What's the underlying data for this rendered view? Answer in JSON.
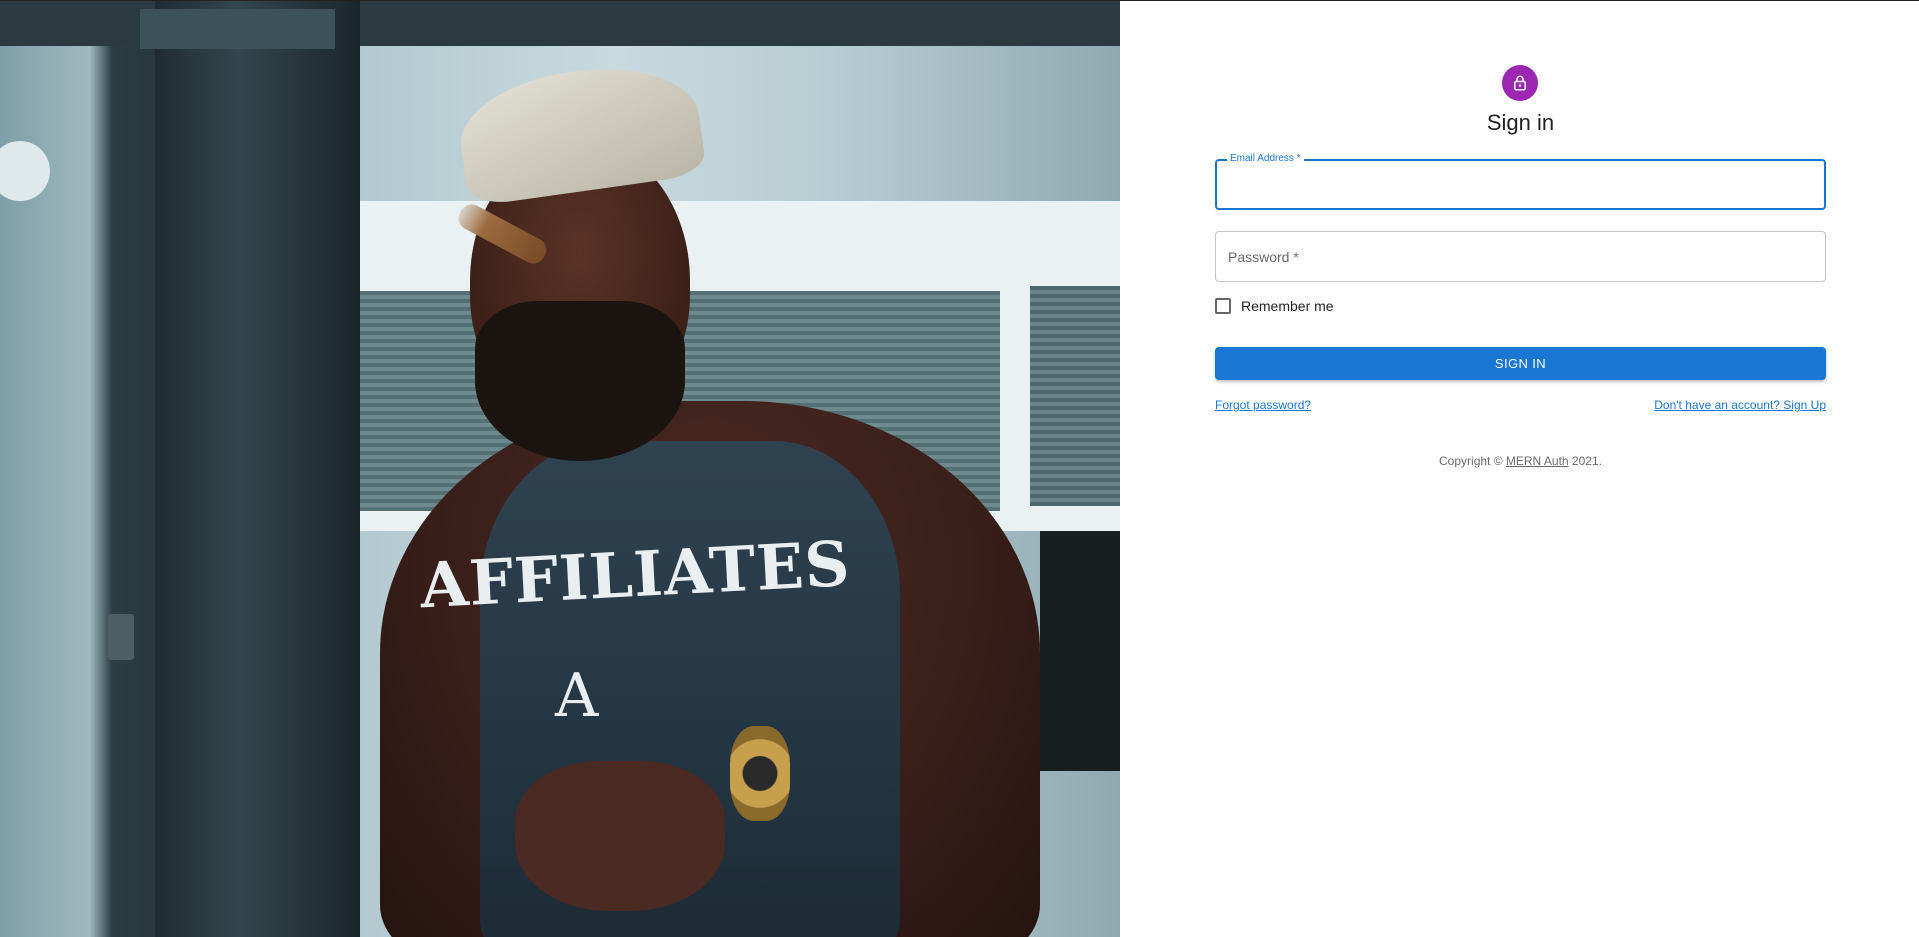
{
  "hero": {
    "shirt_text": "AFFILIATES",
    "shirt_logo": "A"
  },
  "form": {
    "icon": "lock-icon",
    "title": "Sign in",
    "email": {
      "label": "Email Address *",
      "value": "",
      "placeholder": ""
    },
    "password": {
      "label": "Password *",
      "value": "",
      "placeholder": "Password *"
    },
    "remember": {
      "label": "Remember me",
      "checked": false
    },
    "submit_label": "SIGN IN",
    "forgot_link": "Forgot password?",
    "signup_link": "Don't have an account? Sign Up"
  },
  "footer": {
    "prefix": "Copyright © ",
    "link": "MERN Auth",
    "suffix": " 2021."
  },
  "colors": {
    "primary": "#1976d2",
    "avatar": "#9c27b0"
  }
}
